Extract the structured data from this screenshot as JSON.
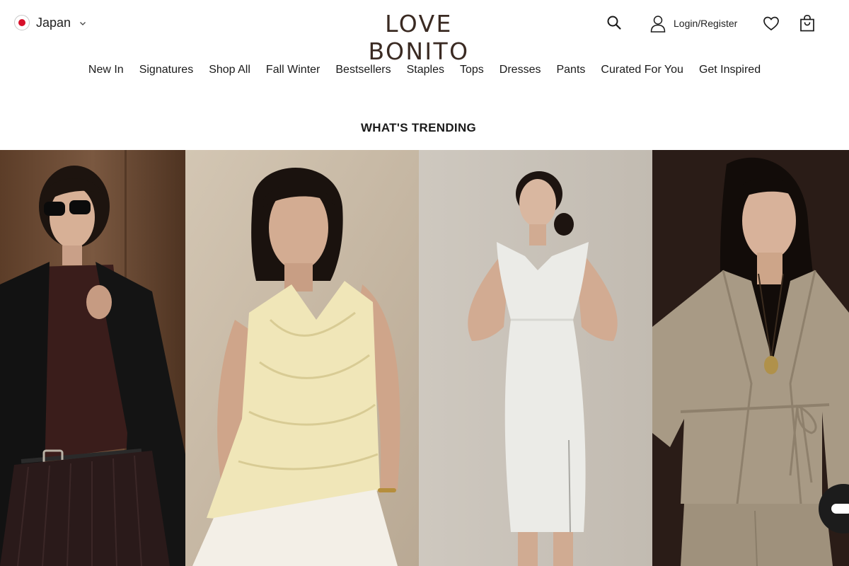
{
  "header": {
    "country": "Japan",
    "logo": "LOVE BONITO",
    "login_label": "Login/Register"
  },
  "nav": {
    "items": [
      "New In",
      "Signatures",
      "Shop All",
      "Fall Winter",
      "Bestsellers",
      "Staples",
      "Tops",
      "Dresses",
      "Pants",
      "Curated For You",
      "Get Inspired"
    ]
  },
  "trending": {
    "title": "WHAT'S TRENDING"
  },
  "icons": {
    "flag": "japan-flag-icon",
    "search": "search-icon",
    "user": "user-icon",
    "wishlist": "heart-icon",
    "bag": "shopping-bag-icon",
    "chat": "chat-icon"
  },
  "colors": {
    "logo": "#3a2a22",
    "text": "#1a1a1a",
    "flag_red": "#d7102a"
  }
}
